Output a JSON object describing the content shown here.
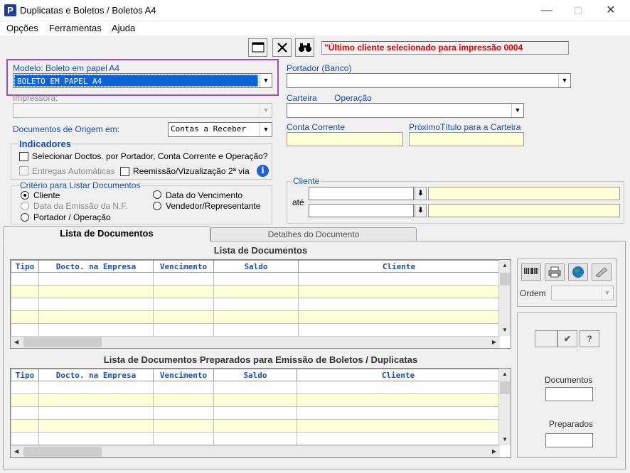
{
  "window": {
    "title": "Duplicatas e Boletos / Boletos A4",
    "app_icon": "P",
    "minimize": "—",
    "maximize": "☐",
    "close": "✕"
  },
  "menu": [
    "Opções",
    "Ferramentas",
    "Ajuda"
  ],
  "toolbar": {
    "message": "\"Último cliente selecionado para impressão 0004"
  },
  "modelo": {
    "label": "Modelo: Boleto em papel A4",
    "value": "BOLETO EM PAPEL A4"
  },
  "impressora": {
    "label": "Impressora:"
  },
  "documentos_origem": {
    "label": "Documentos de Origem em:",
    "value": "Contas a Receber"
  },
  "indicadores": {
    "title": "Indicadores",
    "selecionar": "Selecionar Doctos. por Portador, Conta Corrente  e Operação?",
    "entregas": "Entregas Automáticas",
    "reemissao": "Reemissão/Vizualização 2ª via"
  },
  "criterio": {
    "title": "Critério para Listar Documentos",
    "cliente": "Cliente",
    "data_emissao": "Data da Emissão da N.F.",
    "portador": "Portador / Operação",
    "data_vencimento": "Data do Vencimento",
    "vendedor": "Vendedor/Representante"
  },
  "portador": {
    "label": "Portador (Banco)"
  },
  "carteira": {
    "label": "Carteira",
    "operacao": "Operação"
  },
  "conta_corrente": {
    "label": "Conta Corrente"
  },
  "proximo_titulo": {
    "label": "PróximoTítulo para a Carteira"
  },
  "cliente": {
    "title": "Cliente",
    "ate": "até"
  },
  "tabs": [
    "Lista de Documentos",
    "Detalhes do Documento"
  ],
  "grid1": {
    "title": "Lista de Documentos",
    "columns": [
      "Tipo",
      "Docto. na Empresa",
      "Vencimento",
      "Saldo",
      "Cliente"
    ]
  },
  "grid2": {
    "title": "Lista de Documentos Preparados para Emissão de Boletos / Duplicatas",
    "columns": [
      "Tipo",
      "Docto. na Empresa",
      "Vencimento",
      "Saldo",
      "Cliente"
    ]
  },
  "side": {
    "ordem": "Ordem",
    "documentos": "Documentos",
    "preparados": "Preparados",
    "check": "✔",
    "help": "?"
  }
}
